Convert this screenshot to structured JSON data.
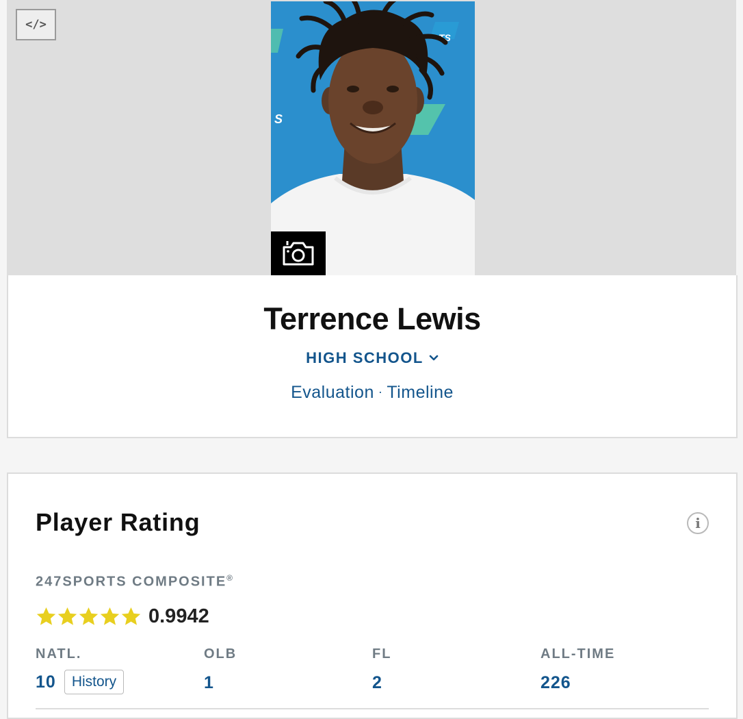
{
  "hero": {
    "embed_icon": "code-icon",
    "embed_glyph": "</>",
    "camera_icon": "camera-icon"
  },
  "profile": {
    "name": "Terrence Lewis",
    "level_selector": "HIGH SCHOOL",
    "links": [
      "Evaluation",
      "Timeline"
    ],
    "link_separator": "·"
  },
  "rating": {
    "title": "Player Rating",
    "info_glyph": "i",
    "composite_label": "247SPORTS COMPOSITE",
    "composite_mark": "®",
    "stars": 5,
    "star_color": "#e8cf1f",
    "score": "0.9942",
    "ranks": [
      {
        "label": "NATL.",
        "value": "10",
        "button": "History"
      },
      {
        "label": "OLB",
        "value": "1"
      },
      {
        "label": "FL",
        "value": "2"
      },
      {
        "label": "ALL-TIME",
        "value": "226"
      }
    ]
  },
  "colors": {
    "link_blue": "#13558c",
    "label_gray": "#6f7b84",
    "hero_bg": "#dedede",
    "photo_bg": "#2b8fcd"
  }
}
